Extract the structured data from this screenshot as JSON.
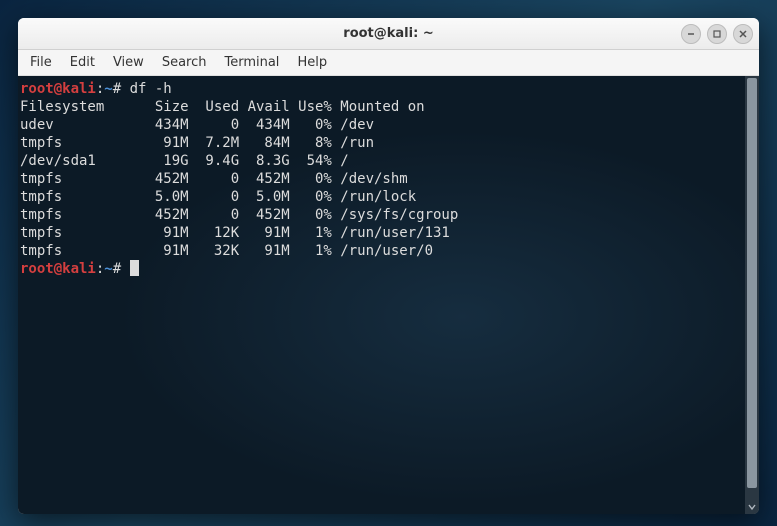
{
  "window": {
    "title": "root@kali: ~"
  },
  "menubar": {
    "items": [
      "File",
      "Edit",
      "View",
      "Search",
      "Terminal",
      "Help"
    ]
  },
  "prompt": {
    "user_host": "root@kali",
    "sep1": ":",
    "path": "~",
    "sep2": "# "
  },
  "command": "df -h",
  "output_header": "Filesystem      Size  Used Avail Use% Mounted on",
  "output_rows": [
    "udev            434M     0  434M   0% /dev",
    "tmpfs            91M  7.2M   84M   8% /run",
    "/dev/sda1        19G  9.4G  8.3G  54% /",
    "tmpfs           452M     0  452M   0% /dev/shm",
    "tmpfs           5.0M     0  5.0M   0% /run/lock",
    "tmpfs           452M     0  452M   0% /sys/fs/cgroup",
    "tmpfs            91M   12K   91M   1% /run/user/131",
    "tmpfs            91M   32K   91M   1% /run/user/0"
  ],
  "chart_data": {
    "type": "table",
    "title": "df -h output",
    "columns": [
      "Filesystem",
      "Size",
      "Used",
      "Avail",
      "Use%",
      "Mounted on"
    ],
    "rows": [
      [
        "udev",
        "434M",
        "0",
        "434M",
        "0%",
        "/dev"
      ],
      [
        "tmpfs",
        "91M",
        "7.2M",
        "84M",
        "8%",
        "/run"
      ],
      [
        "/dev/sda1",
        "19G",
        "9.4G",
        "8.3G",
        "54%",
        "/"
      ],
      [
        "tmpfs",
        "452M",
        "0",
        "452M",
        "0%",
        "/dev/shm"
      ],
      [
        "tmpfs",
        "5.0M",
        "0",
        "5.0M",
        "0%",
        "/run/lock"
      ],
      [
        "tmpfs",
        "452M",
        "0",
        "452M",
        "0%",
        "/sys/fs/cgroup"
      ],
      [
        "tmpfs",
        "91M",
        "12K",
        "91M",
        "1%",
        "/run/user/131"
      ],
      [
        "tmpfs",
        "91M",
        "32K",
        "91M",
        "1%",
        "/run/user/0"
      ]
    ]
  }
}
